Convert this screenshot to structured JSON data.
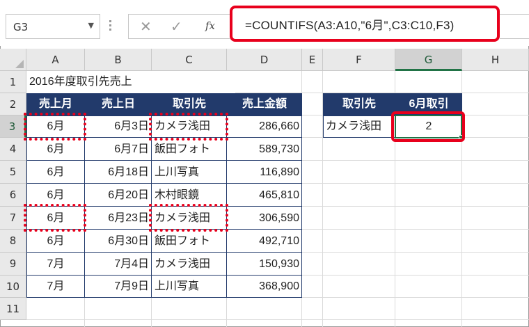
{
  "name_box": {
    "value": "G3"
  },
  "formula_bar": {
    "cancel_icon": "close-icon",
    "enter_icon": "check-icon",
    "fx_label": "fx",
    "formula": "=COUNTIFS(A3:A10,\"6月\",C3:C10,F3)"
  },
  "columns": [
    "A",
    "B",
    "C",
    "D",
    "E",
    "F",
    "G",
    "H"
  ],
  "rows": [
    "1",
    "2",
    "3",
    "4",
    "5",
    "6",
    "7",
    "8",
    "9",
    "10",
    "11"
  ],
  "title": "2016年度取引先売上",
  "table": {
    "headers": [
      "売上月",
      "売上日",
      "取引先",
      "売上金額"
    ],
    "rows": [
      [
        "6月",
        "6月3日",
        "カメラ浅田",
        "286,660"
      ],
      [
        "6月",
        "6月7日",
        "飯田フォト",
        "589,730"
      ],
      [
        "6月",
        "6月18日",
        "上川写真",
        "116,890"
      ],
      [
        "6月",
        "6月20日",
        "木村眼鏡",
        "465,810"
      ],
      [
        "6月",
        "6月23日",
        "カメラ浅田",
        "306,590"
      ],
      [
        "6月",
        "6月30日",
        "飯田フォト",
        "492,710"
      ],
      [
        "7月",
        "7月4日",
        "カメラ浅田",
        "150,930"
      ],
      [
        "7月",
        "7月9日",
        "上川写真",
        "368,900"
      ]
    ]
  },
  "criteria": {
    "headers": [
      "取引先",
      "6月取引"
    ],
    "supplier": "カメラ浅田",
    "result": "2"
  },
  "colors": {
    "header_fill": "#223a6b",
    "highlight": "#e8001c",
    "selection": "#217346"
  }
}
